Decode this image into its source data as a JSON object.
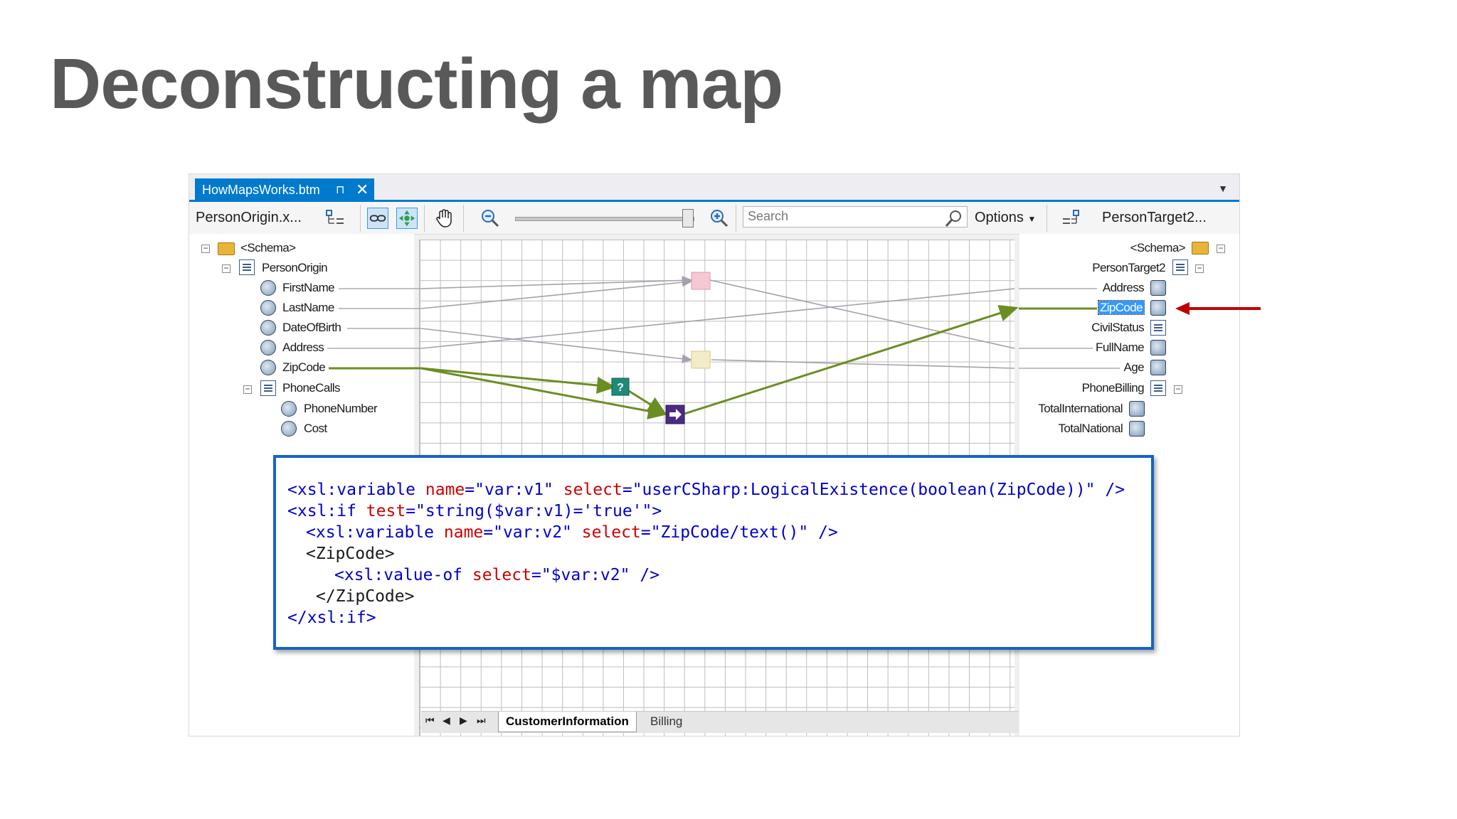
{
  "slide": {
    "title": "Deconstructing a map"
  },
  "document_tab": {
    "label": "HowMapsWorks.btm",
    "pin_glyph": "⊓",
    "close_glyph": "✕"
  },
  "toolbar": {
    "source_schema": "PersonOrigin.x...",
    "search_placeholder": "Search",
    "options_label": "Options",
    "target_schema": "PersonTarget2...",
    "zoom_level_fraction": 0.97
  },
  "source_tree": {
    "root": "<Schema>",
    "record": "PersonOrigin",
    "fields": [
      "FirstName",
      "LastName",
      "DateOfBirth",
      "Address",
      "ZipCode"
    ],
    "sub_record": "PhoneCalls",
    "sub_fields": [
      "PhoneNumber",
      "Cost"
    ]
  },
  "target_tree": {
    "root": "<Schema>",
    "record": "PersonTarget2",
    "fields": [
      "Address",
      "ZipCode",
      "CivilStatus",
      "FullName",
      "Age"
    ],
    "sub_record": "PhoneBilling",
    "sub_fields": [
      "TotalInternational",
      "TotalNational"
    ],
    "selected": "ZipCode"
  },
  "code": {
    "line1": {
      "tag": "<xsl:variable",
      "a1": "name",
      "v1": "=\"var:v1\"",
      "a2": "select",
      "v2": "=\"userCSharp:LogicalExistence(boolean(ZipCode))\"",
      "end": "/>"
    },
    "line2": {
      "tag": "<xsl:if",
      "a1": "test",
      "v1": "=\"string($var:v1)='true'\"",
      "end": ">"
    },
    "line3": {
      "tag": "<xsl:variable",
      "a1": "name",
      "v1": "=\"var:v2\"",
      "a2": "select",
      "v2": "=\"ZipCode/text()\"",
      "end": "/>"
    },
    "line4": {
      "tag": "<ZipCode>"
    },
    "line5": {
      "tag": "<xsl:value-of",
      "a1": "select",
      "v1": "=\"$var:v2\"",
      "end": "/>"
    },
    "line6": {
      "tag": "</ZipCode>"
    },
    "line7": {
      "tag": "</xsl:if>"
    }
  },
  "pages": {
    "active": "CustomerInformation",
    "other": "Billing",
    "nav": [
      "⏮",
      "◀",
      "▶",
      "⏭"
    ]
  },
  "colors": {
    "accent": "#007acc",
    "link_active": "#6b8e23",
    "link_inactive": "#a8a0ac",
    "arrow": "#c00000",
    "code_border": "#1565c0"
  }
}
